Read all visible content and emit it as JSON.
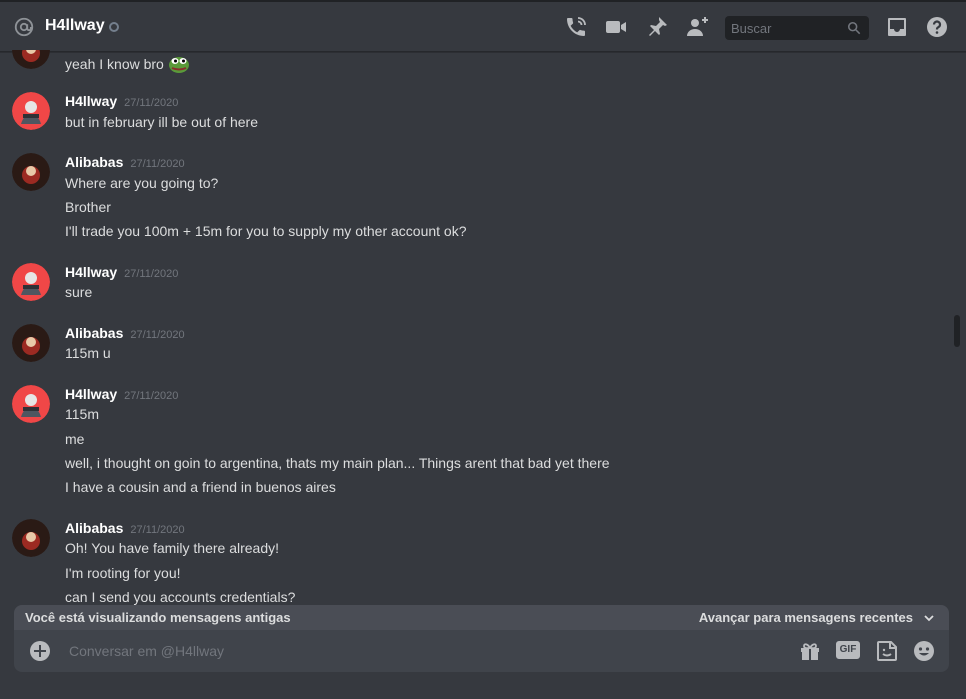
{
  "header": {
    "channel_name": "H4llway",
    "search_placeholder": "Buscar",
    "icons": [
      "at-icon",
      "status-icon",
      "voice-call-icon",
      "video-call-icon",
      "pin-icon",
      "add-friend-icon",
      "search-icon",
      "inbox-icon",
      "help-icon"
    ]
  },
  "colors": {
    "background": "#36393f",
    "header_border": "#202225",
    "input_bg": "#40444b",
    "bar_bg": "#4a4d55",
    "text": "#dcddde",
    "muted": "#72767d",
    "white": "#ffffff"
  },
  "messages": [
    {
      "author": "",
      "timestamp": "",
      "avatar": "alibabas",
      "lines": [
        "yeah I know bro"
      ],
      "emoji": "pepe-emoji"
    },
    {
      "author": "H4llway",
      "timestamp": "27/11/2020",
      "avatar": "h4llway",
      "lines": [
        "but in february ill be out of here"
      ]
    },
    {
      "author": "Alibabas",
      "timestamp": "27/11/2020",
      "avatar": "alibabas",
      "lines": [
        "Where are you going to?",
        "Brother",
        "I'll trade you 100m + 15m for you to supply my other account ok?"
      ]
    },
    {
      "author": "H4llway",
      "timestamp": "27/11/2020",
      "avatar": "h4llway",
      "lines": [
        "sure"
      ]
    },
    {
      "author": "Alibabas",
      "timestamp": "27/11/2020",
      "avatar": "alibabas",
      "lines": [
        "115m u"
      ]
    },
    {
      "author": "H4llway",
      "timestamp": "27/11/2020",
      "avatar": "h4llway",
      "lines": [
        "115m",
        "me",
        "well, i thought on goin to argentina, thats my main plan... Things arent that bad yet there",
        "I have a cousin and a friend in buenos aires"
      ]
    },
    {
      "author": "Alibabas",
      "timestamp": "27/11/2020",
      "avatar": "alibabas",
      "lines": [
        "Oh! You have family there already!",
        "I'm rooting for you!",
        "can I send you accounts credentials?"
      ]
    }
  ],
  "old_messages_bar": {
    "text": "Você está visualizando mensagens antigas",
    "jump_label": "Avançar para mensagens recentes"
  },
  "composer": {
    "placeholder": "Conversar em @H4llway",
    "gif_label": "GIF",
    "icons": [
      "add-attachment-icon",
      "gift-icon",
      "gif-icon",
      "sticker-icon",
      "emoji-icon"
    ]
  }
}
